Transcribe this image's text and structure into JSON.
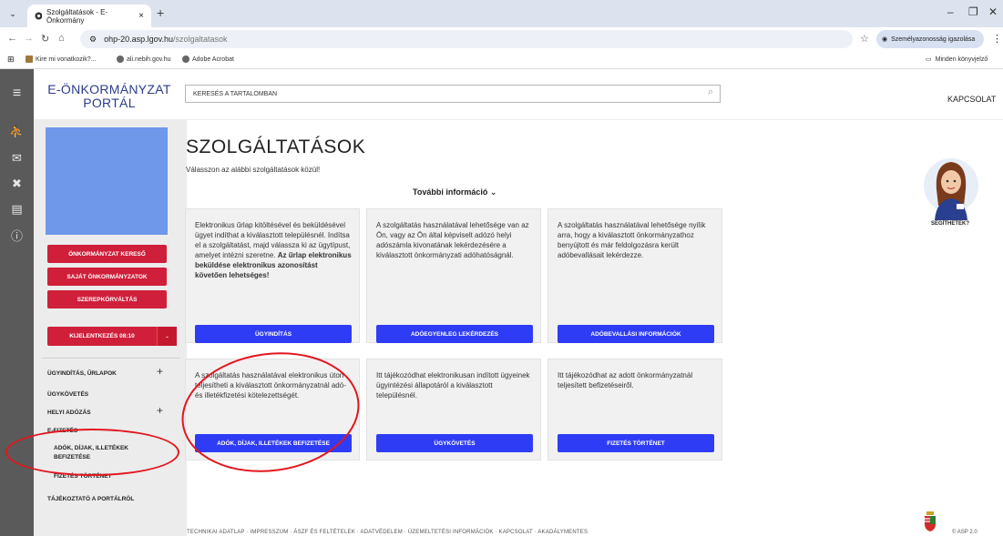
{
  "browser": {
    "tab_title": "Szolgáltatások - E-Önkormány",
    "tab_list_icon": "chevron-down-icon",
    "url_host": "ohp-20.asp.lgov.hu",
    "url_path": "/szolgaltatasok",
    "identity_button": "Személyazonosság igazolása",
    "bookmarks": [
      "Kire mi vonatkozik?...",
      "ali.nebih.gov.hu",
      "Adobe Acrobat"
    ],
    "all_bookmarks": "Minden könyvjelző"
  },
  "header": {
    "logo_line1": "E-ÖNKORMÁNYZAT",
    "logo_line2": "PORTÁL",
    "search_placeholder": "KERESÉS A TARTALOMBAN",
    "contact": "KAPCSOLAT"
  },
  "sidebar": {
    "buttons": [
      "ÖNKORMÁNYZAT KERESŐ",
      "SAJÁT ÖNKORMÁNYZATOK",
      "SZEREPKÖRVÁLTÁS"
    ],
    "logout": "KIJELENTKEZÉS 08:10",
    "logout_minus": "-",
    "nav": [
      {
        "label": "ÜGYINDÍTÁS, ŰRLAPOK",
        "expand": "+"
      },
      {
        "label": "ÜGYKÖVETÉS",
        "expand": ""
      },
      {
        "label": "HELYI ADÓZÁS",
        "expand": "+"
      },
      {
        "label": "E-FIZETÉS",
        "expand": ""
      },
      {
        "label": "ADÓK, DÍJAK, ILLETÉKEK",
        "expand": ""
      },
      {
        "label": "BEFIZETÉSE",
        "expand": ""
      },
      {
        "label": "FIZETÉS TÖRTÉNET",
        "expand": ""
      },
      {
        "label": "TÁJÉKOZTATÓ A PORTÁLRÓL",
        "expand": ""
      }
    ]
  },
  "main": {
    "title": "SZOLGÁLTATÁSOK",
    "subtitle": "Válasszon az alábbi szolgáltatások közül!",
    "more_info": "További információ ⌄",
    "cards": [
      {
        "text": "Elektronikus űrlap kitöltésével és beküldésével ügyet indíthat a kiválasztott településnél. Indítsa el a szolgáltatást, majd válassza ki az ügytípust, amelyet intézni szeretne.",
        "bold": "Az űrlap elektronikus beküldése elektronikus azonosítást követően lehetséges!",
        "button": "ÜGYINDÍTÁS"
      },
      {
        "text": "A szolgáltatás használatával lehetősége van az Ön, vagy az Ön által képviselt adózó helyi adószámla kivonatának lekérdezésére a kiválasztott önkormányzati adóhatóságnál.",
        "bold": "",
        "button": "ADÓEGYENLEG LEKÉRDEZÉS"
      },
      {
        "text": "A szolgáltatás használatával lehetősége nyílik arra, hogy a kiválasztott önkormányzathoz benyújtott és már feldolgozásra került adóbevallásait lekérdezze.",
        "bold": "",
        "button": "ADÓBEVALLÁSI INFORMÁCIÓK"
      },
      {
        "text": "A szolgáltatás használatával elektronikus úton teljesítheti a kiválasztott önkormányzatnál adó- és illetékfizetési kötelezettségét.",
        "bold": "",
        "button": "ADÓK, DÍJAK, ILLETÉKEK BEFIZETÉSE"
      },
      {
        "text": "Itt tájékozódhat elektronikusan indított ügyeinek ügyintézési állapotáról a kiválasztott településnél.",
        "bold": "",
        "button": "ÜGYKÖVETÉS"
      },
      {
        "text": "Itt tájékozódhat az adott önkormányzatnál teljesített befizetéseiről.",
        "bold": "",
        "button": "FIZETÉS TÖRTÉNET"
      }
    ]
  },
  "assistant": {
    "label": "SEGÍTHETEK?"
  },
  "footer": {
    "links": "TECHNIKAI ADATLAP   ·   IMPRESSZUM   ·   ÁSZF ÉS FELTÉTELEK   ·   ADATVÉDELEM   ·   ÜZEMELTETÉSI INFORMÁCIÓK   ·   KAPCSOLAT   ·   AKADÁLYMENTES",
    "right": "© ASP 2.0"
  },
  "colors": {
    "sidebar_red": "#cf1f3a",
    "card_button_blue": "#2f3cf5",
    "annotation_red": "#e3161f",
    "portal_navy": "#2d3c8a"
  }
}
